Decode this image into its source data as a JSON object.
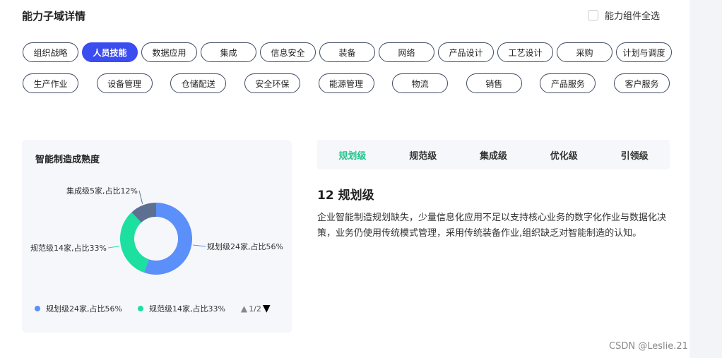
{
  "header": {
    "title": "能力子域详情",
    "select_all_label": "能力组件全选"
  },
  "tags_row1": [
    {
      "label": "组织战略",
      "active": false
    },
    {
      "label": "人员技能",
      "active": true
    },
    {
      "label": "数据应用",
      "active": false
    },
    {
      "label": "集成",
      "active": false
    },
    {
      "label": "信息安全",
      "active": false
    },
    {
      "label": "装备",
      "active": false
    },
    {
      "label": "网络",
      "active": false
    },
    {
      "label": "产品设计",
      "active": false
    },
    {
      "label": "工艺设计",
      "active": false
    },
    {
      "label": "采购",
      "active": false
    },
    {
      "label": "计划与调度",
      "active": false
    }
  ],
  "tags_row2": [
    {
      "label": "生产作业"
    },
    {
      "label": "设备管理"
    },
    {
      "label": "仓储配送"
    },
    {
      "label": "安全环保"
    },
    {
      "label": "能源管理"
    },
    {
      "label": "物流"
    },
    {
      "label": "销售"
    },
    {
      "label": "产品服务"
    },
    {
      "label": "客户服务"
    }
  ],
  "chart_data": {
    "type": "pie",
    "title": "智能制造成熟度",
    "slices": [
      {
        "name": "规划级",
        "count": 24,
        "percent": 56,
        "label": "规划级24家,占比56%",
        "color": "#5b8ff9"
      },
      {
        "name": "规范级",
        "count": 14,
        "percent": 33,
        "label": "规范级14家,占比33%",
        "color": "#1de0a0"
      },
      {
        "name": "集成级",
        "count": 5,
        "percent": 12,
        "label": "集成级5家,占比12%",
        "color": "#5d7092"
      }
    ],
    "legend": {
      "placement": "bottom",
      "items": [
        {
          "label": "规划级24家,占比56%",
          "color": "#5b8ff9"
        },
        {
          "label": "规范级14家,占比33%",
          "color": "#1de0a0"
        }
      ],
      "page": "1/2"
    }
  },
  "level_tabs": [
    {
      "label": "规划级",
      "active": true
    },
    {
      "label": "规范级",
      "active": false
    },
    {
      "label": "集成级",
      "active": false
    },
    {
      "label": "优化级",
      "active": false
    },
    {
      "label": "引领级",
      "active": false
    }
  ],
  "detail": {
    "heading": "12 规划级",
    "description": "企业智能制造规划缺失，少量信息化应用不足以支持核心业务的数字化作业与数据化决策，业务仍使用传统模式管理，采用传统装备作业,组织缺乏对智能制造的认知。"
  },
  "watermark": "CSDN @Leslie.21",
  "colors": {
    "accent": "#3b4cf0",
    "active_tab": "#1fc58a"
  }
}
